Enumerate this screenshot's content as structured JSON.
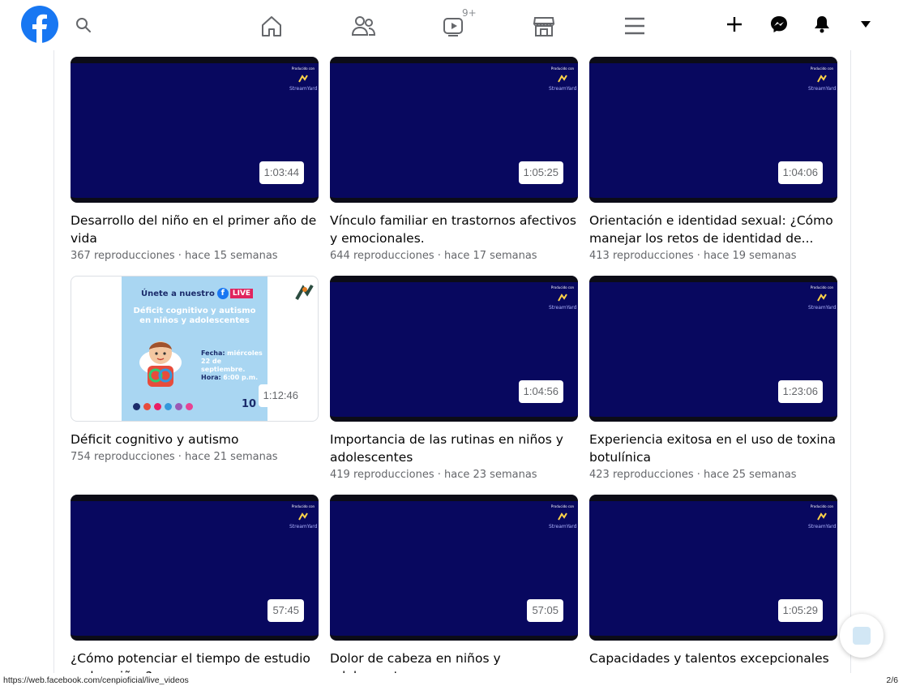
{
  "topbar": {
    "icons": [
      "facebook-logo-icon",
      "search-icon",
      "home-icon",
      "friends-icon",
      "watch-icon",
      "marketplace-icon",
      "menu-icon",
      "plus-icon",
      "messenger-icon",
      "bell-icon",
      "caret-down-icon"
    ],
    "watch_badge": "9+"
  },
  "thumbnail_overlay": {
    "produced_with": "Producido con",
    "brand": "StreamYard"
  },
  "videos": [
    {
      "title": "Desarrollo del niño en el primer año de vida",
      "meta": "367 reproducciones · hace 15 semanas",
      "duration": "1:03:44"
    },
    {
      "title": "Vínculo familiar en trastornos afectivos y emocionales.",
      "meta": "644 reproducciones · hace 17 semanas",
      "duration": "1:05:25"
    },
    {
      "title": "Orientación e identidad sexual: ¿Cómo manejar los retos de identidad de...",
      "meta": "413 reproducciones · hace 19 semanas",
      "duration": "1:04:06"
    },
    {
      "title": "Déficit cognitivo y autismo",
      "meta": "754 reproducciones · hace 21 semanas",
      "duration": "1:12:46"
    },
    {
      "title": "Importancia de las rutinas en niños y adolescentes",
      "meta": "419 reproducciones · hace 23 semanas",
      "duration": "1:04:56"
    },
    {
      "title": "Experiencia exitosa en el uso de toxina botulínica",
      "meta": "423 reproducciones · hace 25 semanas",
      "duration": "1:23:06"
    },
    {
      "title": "¿Cómo potenciar el tiempo de estudio en los niños?",
      "meta": "",
      "duration": "57:45"
    },
    {
      "title": "Dolor de cabeza en niños y adolescentes",
      "meta": "",
      "duration": "57:05"
    },
    {
      "title": "Capacidades y talentos excepcionales",
      "meta": "",
      "duration": "1:05:29"
    }
  ],
  "promo_poster": {
    "heading": "Únete a nuestro",
    "live": "LIVE",
    "title": "Déficit cognitivo y autismo en niños y adolescentes",
    "date_label": "Fecha:",
    "date_value": "miércoles 22 de septiembre.",
    "time_label": "Hora:",
    "time_value": "6:00 p.m.",
    "badge": "10"
  },
  "status": {
    "url": "https://web.facebook.com/cenpioficial/live_videos",
    "page": "2/6"
  }
}
